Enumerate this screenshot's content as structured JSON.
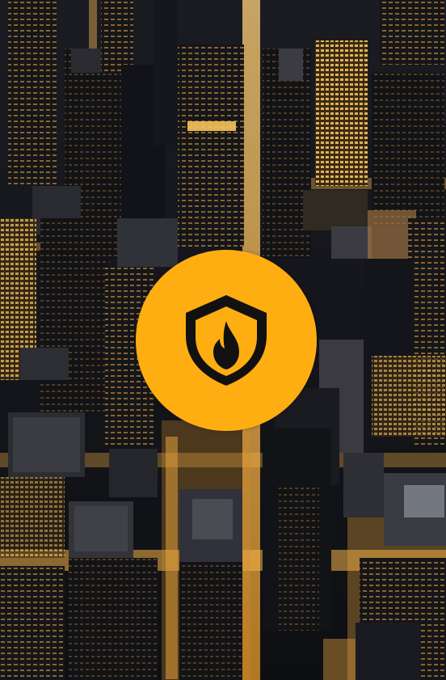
{
  "badge": {
    "icon": "fire-shield-icon",
    "background_color": "#FFAE12",
    "icon_color": "#111111"
  },
  "background": {
    "subject": "aerial-night-city-skyscrapers",
    "light_color": "#F5B342",
    "shadow_color": "#0E1014"
  }
}
